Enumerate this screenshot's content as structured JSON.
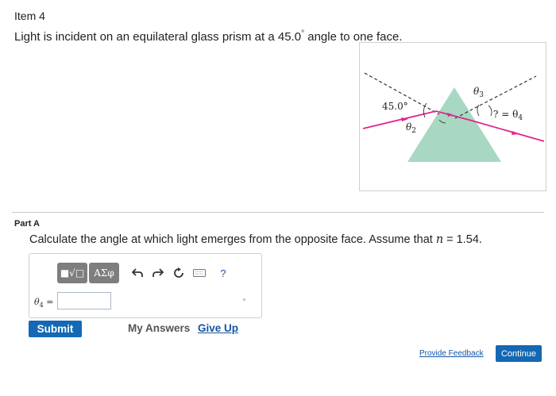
{
  "item_label": "Item 4",
  "problem": {
    "text_before": "Light is incident on an equilateral glass prism at a 45.0",
    "degree": "°",
    "text_after": " angle to one face."
  },
  "figure": {
    "label_45": "45.0°",
    "label_theta2": "θ",
    "label_theta2_sub": "2",
    "label_theta3": "θ",
    "label_theta3_sub": "3",
    "label_theta4_prefix": "? = θ",
    "label_theta4_sub": "4",
    "colors": {
      "prism": "#a8d8c2",
      "ray": "#e0248c",
      "dashes": "#333333"
    }
  },
  "part": {
    "label": "Part A",
    "question_before": "Calculate the angle at which light emerges from the opposite face. Assume that ",
    "question_var": "n",
    "question_after": " = 1.54."
  },
  "toolbar": {
    "template_icon": "■√□",
    "greek_label": "AΣφ",
    "undo_icon": "undo-icon",
    "redo_icon": "redo-icon",
    "reset_icon": "reset-icon",
    "keyboard_icon": "keyboard-icon",
    "help_label": "?"
  },
  "answer": {
    "variable": "θ",
    "variable_sub": "4",
    "equals": " =",
    "value": ""
  },
  "buttons": {
    "submit": "Submit",
    "my_answers": "My Answers",
    "give_up": "Give Up",
    "feedback": "Provide Feedback",
    "continue": "Continue"
  }
}
